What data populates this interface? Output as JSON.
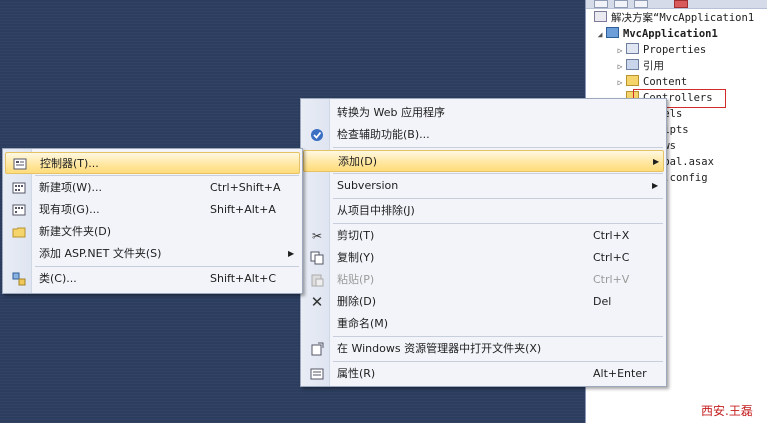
{
  "solution_explorer": {
    "solution_label": "解决方案“MvcApplication1",
    "project_label": "MvcApplication1",
    "items": [
      {
        "label": "Properties",
        "icon": "properties-icon"
      },
      {
        "label": "引用",
        "icon": "references-icon"
      },
      {
        "label": "Content",
        "icon": "folder-icon"
      },
      {
        "label": "Controllers",
        "icon": "folder-icon"
      },
      {
        "label": "dels",
        "icon": "folder-icon"
      },
      {
        "label": "ripts",
        "icon": "folder-icon"
      },
      {
        "label": "ews",
        "icon": "folder-icon"
      },
      {
        "label": "obal.asax",
        "icon": "file-icon"
      },
      {
        "label": "b.config",
        "icon": "file-icon"
      }
    ],
    "highlight_color": "#d22b2b"
  },
  "context_menu": {
    "items": [
      {
        "label": "转换为 Web 应用程序",
        "shortcut": "",
        "icon": "",
        "disabled": false
      },
      {
        "label": "检查辅助功能(B)...",
        "shortcut": "",
        "icon": "accessibility-icon",
        "disabled": false
      },
      {
        "label": "添加(D)",
        "shortcut": "",
        "icon": "",
        "disabled": false,
        "submenu": true,
        "highlighted": true
      },
      {
        "label": "Subversion",
        "shortcut": "",
        "icon": "",
        "disabled": false,
        "submenu": true
      },
      {
        "label": "从项目中排除(J)",
        "shortcut": "",
        "icon": "",
        "disabled": false
      },
      {
        "label": "剪切(T)",
        "shortcut": "Ctrl+X",
        "icon": "cut-icon",
        "disabled": false
      },
      {
        "label": "复制(Y)",
        "shortcut": "Ctrl+C",
        "icon": "copy-icon",
        "disabled": false
      },
      {
        "label": "粘贴(P)",
        "shortcut": "Ctrl+V",
        "icon": "paste-icon",
        "disabled": true
      },
      {
        "label": "删除(D)",
        "shortcut": "Del",
        "icon": "delete-icon",
        "disabled": false
      },
      {
        "label": "重命名(M)",
        "shortcut": "",
        "icon": "",
        "disabled": false
      },
      {
        "label": "在 Windows 资源管理器中打开文件夹(X)",
        "shortcut": "",
        "icon": "open-folder-icon",
        "disabled": false
      },
      {
        "label": "属性(R)",
        "shortcut": "Alt+Enter",
        "icon": "properties-icon",
        "disabled": false
      }
    ]
  },
  "add_submenu": {
    "items": [
      {
        "label": "控制器(T)...",
        "shortcut": "",
        "icon": "controller-icon",
        "highlighted": true
      },
      {
        "label": "新建项(W)...",
        "shortcut": "Ctrl+Shift+A",
        "icon": "new-item-icon"
      },
      {
        "label": "现有项(G)...",
        "shortcut": "Shift+Alt+A",
        "icon": "existing-item-icon"
      },
      {
        "label": "新建文件夹(D)",
        "shortcut": "",
        "icon": "new-folder-icon"
      },
      {
        "label": "添加 ASP.NET 文件夹(S)",
        "shortcut": "",
        "icon": "",
        "submenu": true
      },
      {
        "label": "类(C)...",
        "shortcut": "Shift+Alt+C",
        "icon": "class-icon"
      }
    ]
  },
  "watermark": "西安.王磊",
  "colors": {
    "workspace": "#2c3d5f",
    "menu_bg": "#f2f4f9",
    "highlight": "#ffe9a8",
    "watermark": "#c42020"
  }
}
